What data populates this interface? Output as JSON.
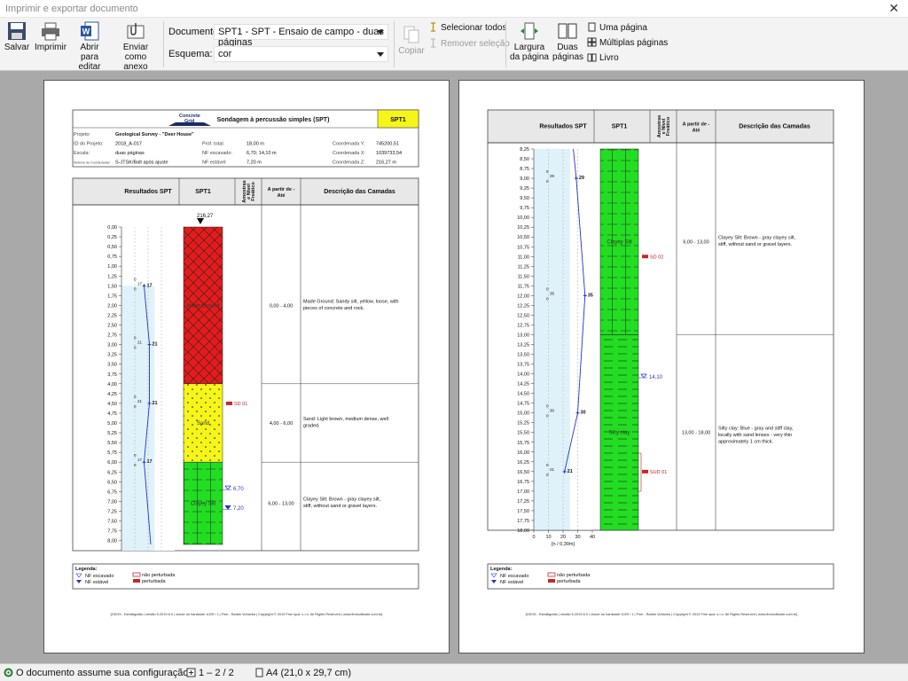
{
  "window": {
    "title": "Imprimir e exportar documento"
  },
  "toolbar": {
    "save": "Salvar",
    "print": "Imprimir",
    "open_edit_1": "Abrir para",
    "open_edit_2": "editar",
    "send_1": "Enviar",
    "send_2": "como anexo",
    "document_label": "Documento:",
    "document_value": "SPT1 - SPT - Ensaio de campo - duas páginas",
    "scheme_label": "Esquema:",
    "scheme_value": "cor",
    "copy": "Copiar",
    "select_all": "Selecionar todos",
    "remove_selection": "Remover seleção",
    "page_width_1": "Largura",
    "page_width_2": "da página",
    "two_pages_1": "Duas",
    "two_pages_2": "páginas",
    "one_page": "Uma página",
    "multiple_pages": "Múltiplas páginas",
    "book": "Livro"
  },
  "report": {
    "logo_1": "Concrete",
    "logo_2": "Grid",
    "title": "Sondagem à percussão simples (SPT)",
    "test_id": "SPT1",
    "header_rows": [
      {
        "k": "Projeto:",
        "v": "Geological Survey - \"Deer House\"",
        "k2": "",
        "v2": "",
        "k3": "",
        "v3": ""
      },
      {
        "k": "ID do Projeto:",
        "v": "2018_A-017",
        "k2": "Prof. total:",
        "v2": "18,00 m",
        "k3": "Coordenada Y:",
        "v3": "745200,51"
      },
      {
        "k": "Escala:",
        "v": "duas páginas",
        "k2": "NF escavado:",
        "v2": "6,70; 14,10 m",
        "k3": "Coordenada X:",
        "v3": "1039733,54"
      },
      {
        "k": "Sistema de Coordenadas:",
        "v": "S-JTSK/Balt após ajuste",
        "k2": "NF estável:",
        "v2": "7,20 m",
        "k3": "Coordenada Z:",
        "v3": "216,27 m"
      }
    ],
    "columns": {
      "spt": "Resultados SPT",
      "log": "SPT1",
      "samples_1": "Amostras",
      "samples_2": "e Nível",
      "samples_3": "Freático",
      "from_1": "A partir de -",
      "from_2": "Até",
      "desc": "Descrição das Camadas"
    },
    "elevation": "216,27",
    "depth_ticks_p1": [
      "0,00",
      "0,25",
      "0,50",
      "0,75",
      "1,00",
      "1,25",
      "1,50",
      "1,75",
      "2,00",
      "2,25",
      "2,50",
      "2,75",
      "3,00",
      "3,25",
      "3,50",
      "3,75",
      "4,00",
      "4,25",
      "4,50",
      "4,75",
      "5,00",
      "5,25",
      "5,50",
      "5,75",
      "6,00",
      "6,25",
      "6,50",
      "6,75",
      "7,00",
      "7,25",
      "7,50",
      "7,75",
      "8,00"
    ],
    "depth_ticks_p2": [
      "8,25",
      "8,50",
      "8,75",
      "9,00",
      "9,25",
      "9,50",
      "9,75",
      "10,00",
      "10,25",
      "10,50",
      "10,75",
      "11,00",
      "11,25",
      "11,50",
      "11,75",
      "12,00",
      "12,25",
      "12,50",
      "12,75",
      "13,00",
      "13,25",
      "13,50",
      "13,75",
      "14,00",
      "14,25",
      "14,50",
      "14,75",
      "15,00",
      "15,25",
      "15,50",
      "15,75",
      "16,00",
      "16,25",
      "16,50",
      "16,75",
      "17,00",
      "17,25",
      "17,50",
      "17,75",
      "18,00"
    ],
    "spt_p1": [
      {
        "d": 1.5,
        "n": "17"
      },
      {
        "d": 3.0,
        "n": "21"
      },
      {
        "d": 4.5,
        "n": "21"
      },
      {
        "d": 6.0,
        "n": "17"
      }
    ],
    "spt_p2": [
      {
        "d": 9.0,
        "n": "29"
      },
      {
        "d": 12.0,
        "n": "35"
      },
      {
        "d": 15.0,
        "n": "30"
      },
      {
        "d": 16.5,
        "n": "21"
      }
    ],
    "spt_axis": [
      "0",
      "10",
      "20",
      "30",
      "40"
    ],
    "spt_axis_label": "[n / 0,30m]",
    "layers_p1": [
      {
        "from": 0,
        "to": 4,
        "range": "0,00 - 4,00",
        "desc": "Made Ground: Sandy silt, yellow, loose, with pieces of concrete and rock.",
        "name": "Made Ground",
        "kind": "made",
        "color": "#e51b1b"
      },
      {
        "from": 4,
        "to": 6,
        "range": "4,00 - 6,00",
        "desc": "Sand: Light brown, medium dense, well graded.",
        "name": "Sand",
        "kind": "sand",
        "color": "#f5f51a"
      },
      {
        "from": 6,
        "to": 8.1,
        "range": "6,00 - 13,00",
        "desc": "Clayey Silt: Brown - gray clayey silt, stiff, without sand or gravel layers.",
        "name": "Clayey Silt",
        "kind": "silt",
        "color": "#22dd22"
      }
    ],
    "layers_p2": [
      {
        "from": 8.1,
        "to": 13,
        "range": "6,00 - 13,00",
        "desc": "Clayey Silt: Brown - gray clayey silt, stiff, without sand or gravel layers.",
        "name": "Clayey Silt",
        "kind": "silt",
        "color": "#22dd22"
      },
      {
        "from": 13,
        "to": 18,
        "range": "13,00 - 18,00",
        "desc": "Silty clay: Blue - gray and stiff clay, locally with sand lenses - very thin approximately 1 cm thick.",
        "name": "Silty clay",
        "kind": "clay",
        "color": "#22dd22"
      }
    ],
    "samples_p1": [
      {
        "d": 4.5,
        "label": "SD 01"
      }
    ],
    "samples_p2": [
      {
        "d": 11.0,
        "label": "SD 02"
      },
      {
        "d": 16.5,
        "label": "SUD 01"
      }
    ],
    "water_p1": [
      {
        "d": 6.7,
        "label": "6,70",
        "type": "escavado"
      },
      {
        "d": 7.2,
        "label": "7,20",
        "type": "estavel"
      }
    ],
    "water_p2": [
      {
        "d": 14.1,
        "label": "14,10",
        "type": "escavado"
      }
    ],
    "legend": {
      "title": "Legenda:",
      "nf_escavado": "NF escavado",
      "nf_estavel": "NF estável",
      "nao_perturbada": "não perturbada",
      "perturbada": "perturbada"
    },
    "footer": "[GEO5 - Estratigrafia | versão 5.2019.6.0 | chave do hardware 1029 / 1 | Fine - Radek Voňavka | Copyright © 2019 Fine spol. s r.o. All Rights Reserved | www.finesoftware.com.br]"
  },
  "status": {
    "config": "O documento assume sua configuração",
    "pages": "1 – 2 / 2",
    "paper": "A4 (21,0 x 29,7 cm)"
  }
}
